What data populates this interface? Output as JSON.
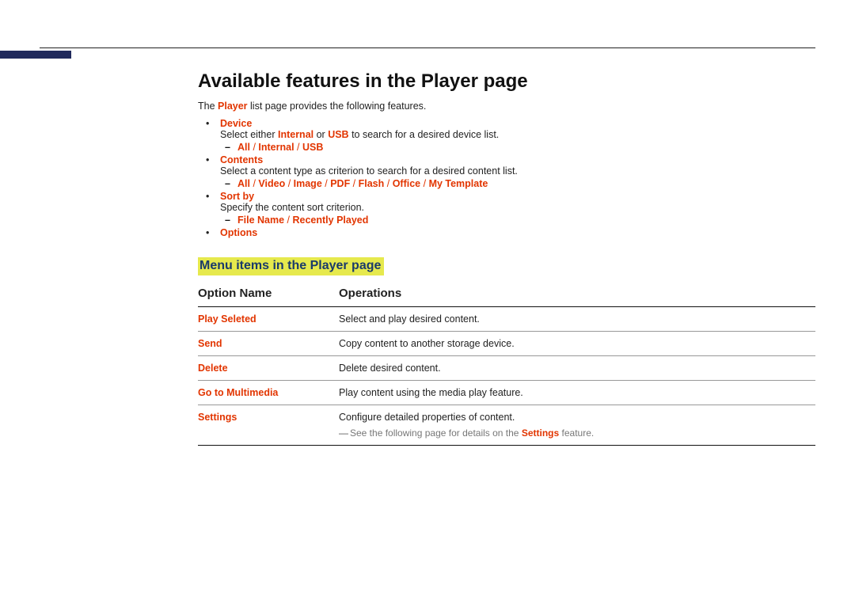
{
  "title": "Available features in the Player page",
  "intro_pre": "The ",
  "intro_bold": "Player",
  "intro_post": " list page provides the following features.",
  "features": {
    "device": {
      "label": "Device",
      "desc_pre": "Select either ",
      "desc_b1": "Internal",
      "desc_mid": " or ",
      "desc_b2": "USB",
      "desc_post": " to search for a desired device list.",
      "opts": [
        "All",
        "Internal",
        "USB"
      ]
    },
    "contents": {
      "label": "Contents",
      "desc": "Select a content type as criterion to search for a desired content list.",
      "opts": [
        "All",
        "Video",
        "Image",
        "PDF",
        "Flash",
        "Office",
        "My Template"
      ]
    },
    "sortby": {
      "label": "Sort by",
      "desc": "Specify the content sort criterion.",
      "opts": [
        "File Name",
        "Recently Played"
      ]
    },
    "options": {
      "label": "Options"
    }
  },
  "section2_title": "Menu items in the Player page",
  "table": {
    "col1": "Option Name",
    "col2": "Operations",
    "rows": [
      {
        "name": "Play Seleted",
        "op": "Select and play desired content."
      },
      {
        "name": "Send",
        "op": "Copy content to another storage device."
      },
      {
        "name": "Delete",
        "op": "Delete desired content."
      },
      {
        "name": "Go to Multimedia",
        "op": "Play content using the media play feature."
      },
      {
        "name": "Settings",
        "op": "Configure detailed properties of content."
      }
    ],
    "note_pre": "See the following page for details on the ",
    "note_bold": "Settings",
    "note_post": " feature."
  }
}
